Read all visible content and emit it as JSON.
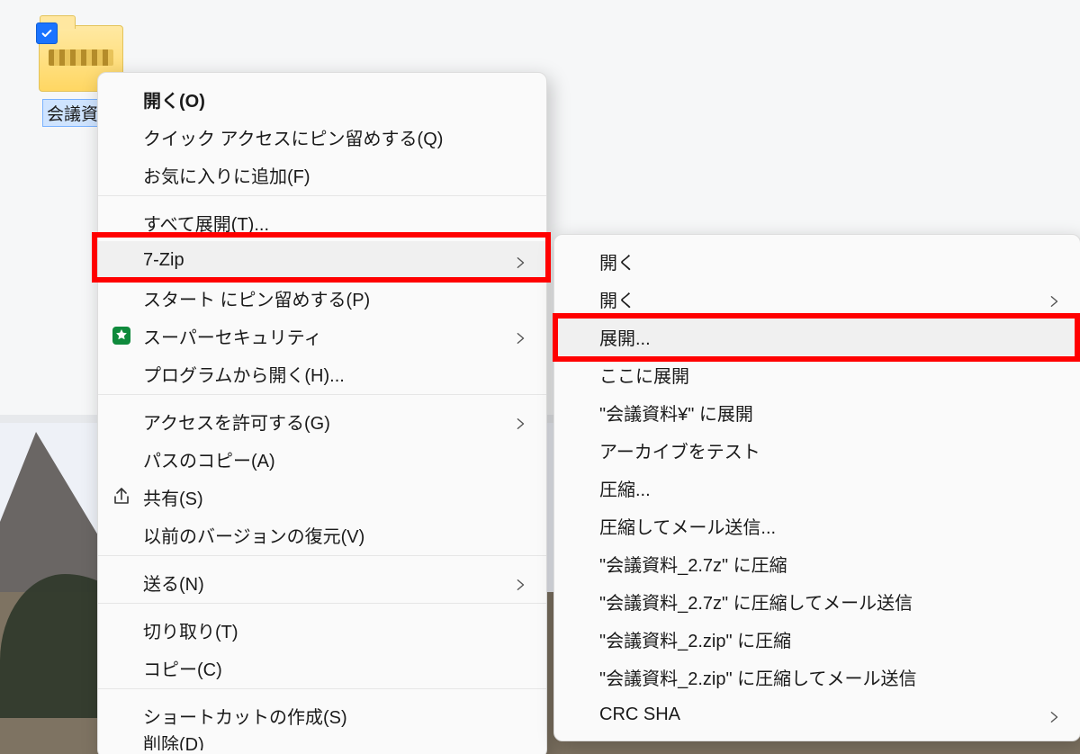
{
  "desktop": {
    "file_label": "会議資料"
  },
  "menu": {
    "open": "開く(O)",
    "pin_quick": "クイック アクセスにピン留めする(Q)",
    "add_fav": "お気に入りに追加(F)",
    "extract_all": "すべて展開(T)...",
    "sevenzip": "7-Zip",
    "pin_start": "スタート にピン留めする(P)",
    "super_security": "スーパーセキュリティ",
    "open_with": "プログラムから開く(H)...",
    "give_access": "アクセスを許可する(G)",
    "copy_path": "パスのコピー(A)",
    "share": "共有(S)",
    "restore_prev": "以前のバージョンの復元(V)",
    "send_to": "送る(N)",
    "cut": "切り取り(T)",
    "copy": "コピー(C)",
    "create_shortcut": "ショートカットの作成(S)",
    "delete": "削除(D)"
  },
  "sub": {
    "open1": "開く",
    "open2": "開く",
    "extract": "展開...",
    "extract_here": "ここに展開",
    "extract_to": "\"会議資料¥\" に展開",
    "test": "アーカイブをテスト",
    "compress": "圧縮...",
    "compress_mail": "圧縮してメール送信...",
    "to_7z": "\"会議資料_2.7z\" に圧縮",
    "to_7z_mail": "\"会議資料_2.7z\" に圧縮してメール送信",
    "to_zip": "\"会議資料_2.zip\" に圧縮",
    "to_zip_mail": "\"会議資料_2.zip\" に圧縮してメール送信",
    "crc": "CRC SHA"
  },
  "callouts": {
    "main_highlight_item": "sevenzip",
    "sub_highlight_item": "extract"
  }
}
